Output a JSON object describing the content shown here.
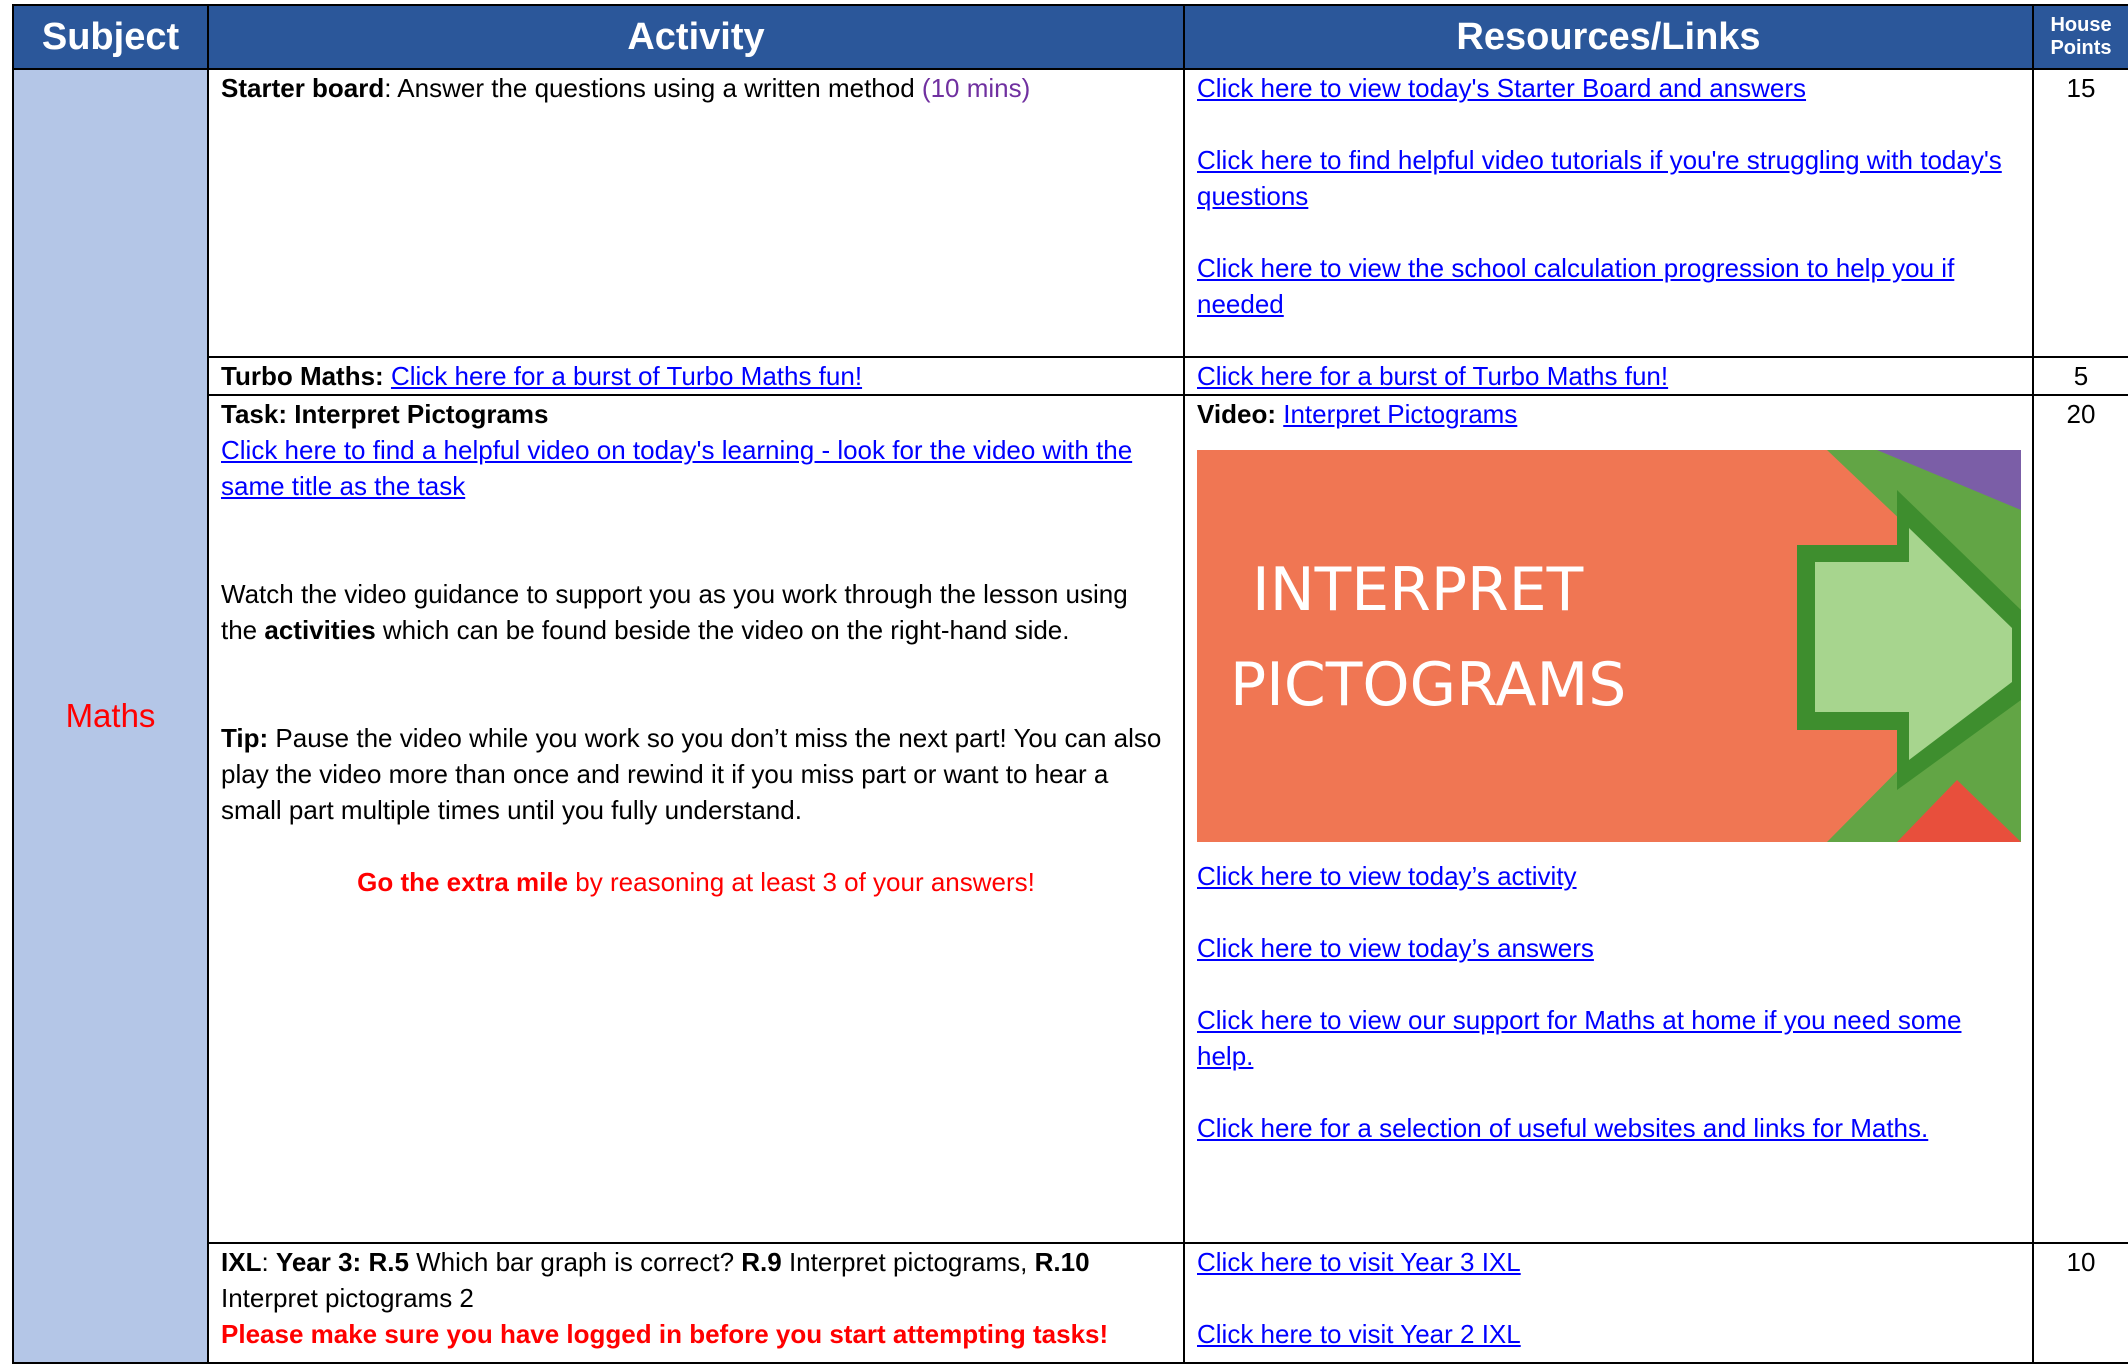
{
  "header": {
    "subject": "Subject",
    "activity": "Activity",
    "resources": "Resources/Links",
    "house_points_line1": "House",
    "house_points_line2": "Points"
  },
  "subject": "Maths",
  "rows": {
    "starter": {
      "label": "Starter board",
      "text": ": Answer the questions using a written method",
      "time": "(10 mins)",
      "links": [
        "Click here to view today's Starter Board and answers",
        "Click here to find helpful video tutorials if you're struggling with today's questions",
        "Click here to view the school calculation progression to help you if needed"
      ],
      "points": "15"
    },
    "turbo": {
      "label": "Turbo Maths:",
      "activity_link": "Click here for a burst of Turbo Maths fun!",
      "resource_link": "Click here for a burst of Turbo Maths fun!",
      "points": "5"
    },
    "task": {
      "label": "Task: Interpret Pictograms",
      "video_link": "Click here to find a helpful video on today's learning - look for the video with the same title as the task",
      "watch_pre": "Watch the video guidance to support you as you work through the lesson using the ",
      "watch_bold": "activities",
      "watch_post": " which can be found beside the video on the right-hand side.",
      "tip_label": "Tip:",
      "tip_text": " Pause the video while you work so you don’t miss the next part! You can also play the video more than once and rewind it if you miss part or want to hear a small part multiple times until you fully understand.",
      "extra_bold": "Go the extra mile",
      "extra_text": " by reasoning at least 3 of your answers!",
      "video_label": "Video:",
      "video_title_link": "Interpret Pictograms",
      "banner_line1": "INTERPRET",
      "banner_line2": "PICTOGRAMS",
      "resource_links": [
        "Click here to view today’s activity",
        "Click here to view today’s answers",
        "Click here to view our support for Maths at home if you need some help.",
        "Click here for a selection of useful websites and links for Maths."
      ],
      "points": "20"
    },
    "ixl": {
      "label": "IXL",
      "year": "Year 3:",
      "r5": "R.5",
      "r5_text": " Which bar graph is correct? ",
      "r9": "R.9",
      "r9_text": " Interpret pictograms, ",
      "r10": "R.10",
      "r10_text": " Interpret pictograms 2",
      "warning": "Please make sure you have logged in before you start attempting tasks!",
      "links": [
        "Click here to visit Year 3 IXL",
        "Click here to visit Year 2 IXL"
      ],
      "points": "10"
    }
  },
  "colors": {
    "header_bg": "#2b579a",
    "subject_bg": "#b4c6e7",
    "subject_text": "#ff0000",
    "link": "#0000ff",
    "banner_orange": "#f07653",
    "banner_green": "#62a545",
    "banner_purple": "#7b5ea7"
  }
}
